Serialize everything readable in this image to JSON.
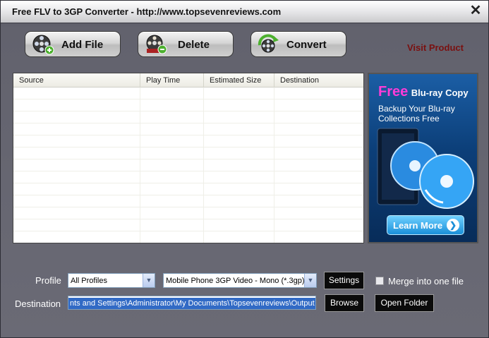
{
  "window": {
    "title": "Free FLV to 3GP Converter - http://www.topsevenreviews.com"
  },
  "toolbar": {
    "add_file": "Add File",
    "delete": "Delete",
    "convert": "Convert",
    "visit_product": "Visit Product"
  },
  "table": {
    "columns": [
      "Source",
      "Play Time",
      "Estimated Size",
      "Destination"
    ],
    "rows": []
  },
  "ad": {
    "free": "Free",
    "product": "Blu-ray Copy",
    "tagline": "Backup Your Blu-ray Collections Free",
    "button": "Learn More"
  },
  "profile": {
    "label": "Profile",
    "category_value": "All Profiles",
    "format_value": "Mobile Phone 3GP Video - Mono (*.3gp)",
    "settings_label": "Settings",
    "merge_label": "Merge into one file",
    "merge_checked": false
  },
  "destination": {
    "label": "Destination",
    "value": "nts and Settings\\Administrator\\My Documents\\Topsevenreviews\\Output",
    "browse_label": "Browse",
    "open_folder_label": "Open Folder"
  },
  "icons": {
    "add_file": "film-reel-plus-icon",
    "delete": "film-reel-minus-icon",
    "convert": "film-convert-icon",
    "close": "close-icon"
  },
  "colors": {
    "visit_product": "#7a1010",
    "ad_accent": "#ff3bd8",
    "selection": "#316ac5"
  }
}
